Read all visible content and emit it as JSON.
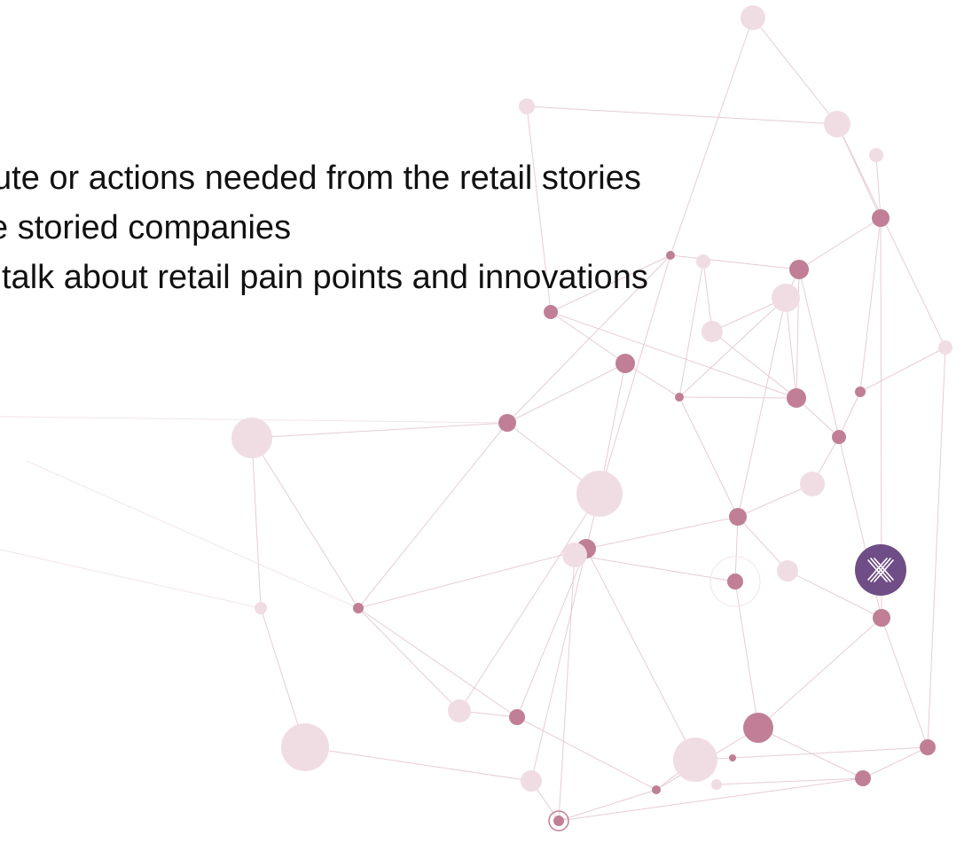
{
  "slide": {
    "bullets": [
      "ute or actions needed from the retail stories",
      "e storied companies",
      "talk about retail pain points and innovations"
    ],
    "logo": {
      "icon": "x-logo-icon",
      "color": "#6f4d86"
    },
    "background": {
      "icon": "network-graph",
      "node_color_dark": "#c07f96",
      "node_color_light": "#f0dde3",
      "line_color": "#e7ccd6"
    }
  }
}
